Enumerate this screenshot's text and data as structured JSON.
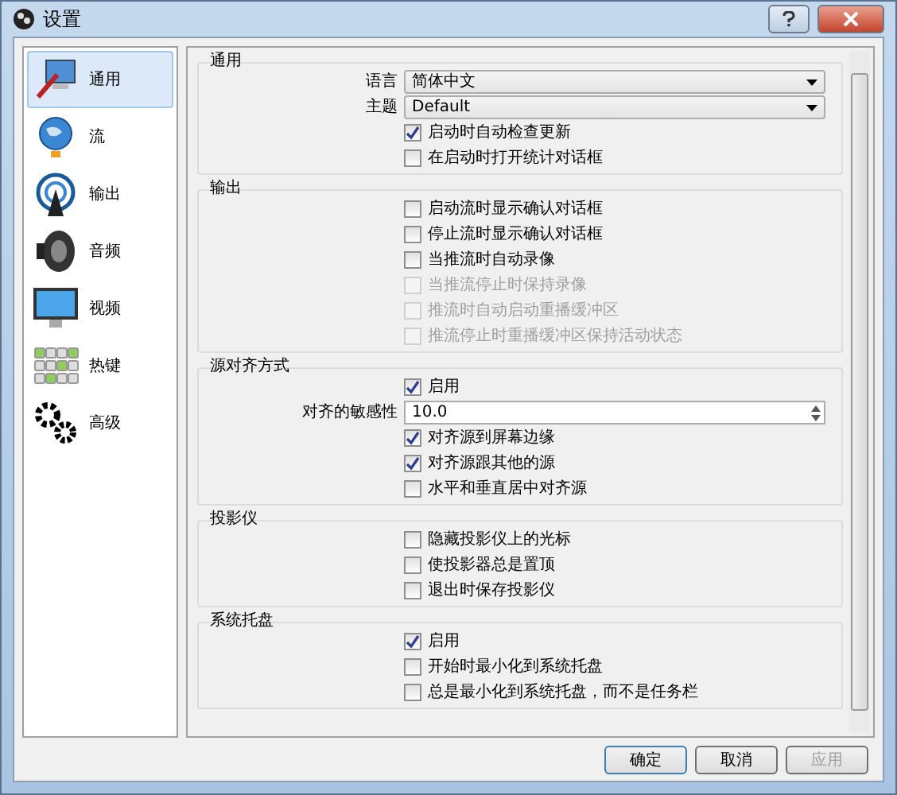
{
  "window": {
    "title": "设置"
  },
  "sidebar": {
    "items": [
      {
        "kind": "general",
        "label": "通用",
        "selected": true
      },
      {
        "kind": "stream",
        "label": "流",
        "selected": false
      },
      {
        "kind": "output",
        "label": "输出",
        "selected": false
      },
      {
        "kind": "audio",
        "label": "音频",
        "selected": false
      },
      {
        "kind": "video",
        "label": "视频",
        "selected": false
      },
      {
        "kind": "hotkeys",
        "label": "热键",
        "selected": false
      },
      {
        "kind": "advanced",
        "label": "高级",
        "selected": false
      }
    ]
  },
  "sections": [
    {
      "title": "通用",
      "items": [
        {
          "kind": "select",
          "label": "语言",
          "value": "简体中文"
        },
        {
          "kind": "select",
          "label": "主题",
          "value": "Default"
        },
        {
          "kind": "checkbox",
          "label": "启动时自动检查更新",
          "checked": true,
          "disabled": false
        },
        {
          "kind": "checkbox",
          "label": "在启动时打开统计对话框",
          "checked": false,
          "disabled": false
        }
      ]
    },
    {
      "title": "输出",
      "items": [
        {
          "kind": "checkbox",
          "label": "启动流时显示确认对话框",
          "checked": false,
          "disabled": false
        },
        {
          "kind": "checkbox",
          "label": "停止流时显示确认对话框",
          "checked": false,
          "disabled": false
        },
        {
          "kind": "checkbox",
          "label": "当推流时自动录像",
          "checked": false,
          "disabled": false
        },
        {
          "kind": "checkbox",
          "label": "当推流停止时保持录像",
          "checked": false,
          "disabled": true
        },
        {
          "kind": "checkbox",
          "label": "推流时自动启动重播缓冲区",
          "checked": false,
          "disabled": true
        },
        {
          "kind": "checkbox",
          "label": "推流停止时重播缓冲区保持活动状态",
          "checked": false,
          "disabled": true
        }
      ]
    },
    {
      "title": "源对齐方式",
      "items": [
        {
          "kind": "checkbox",
          "label": "启用",
          "checked": true,
          "disabled": false
        },
        {
          "kind": "spin",
          "label": "对齐的敏感性",
          "value": "10.0"
        },
        {
          "kind": "checkbox",
          "label": "对齐源到屏幕边缘",
          "checked": true,
          "disabled": false
        },
        {
          "kind": "checkbox",
          "label": "对齐源跟其他的源",
          "checked": true,
          "disabled": false
        },
        {
          "kind": "checkbox",
          "label": "水平和垂直居中对齐源",
          "checked": false,
          "disabled": false
        }
      ]
    },
    {
      "title": "投影仪",
      "items": [
        {
          "kind": "checkbox",
          "label": "隐藏投影仪上的光标",
          "checked": false,
          "disabled": false
        },
        {
          "kind": "checkbox",
          "label": "使投影器总是置顶",
          "checked": false,
          "disabled": false
        },
        {
          "kind": "checkbox",
          "label": "退出时保存投影仪",
          "checked": false,
          "disabled": false
        }
      ]
    },
    {
      "title": "系统托盘",
      "items": [
        {
          "kind": "checkbox",
          "label": "启用",
          "checked": true,
          "disabled": false
        },
        {
          "kind": "checkbox",
          "label": "开始时最小化到系统托盘",
          "checked": false,
          "disabled": false
        },
        {
          "kind": "checkbox",
          "label": "总是最小化到系统托盘，而不是任务栏",
          "checked": false,
          "disabled": false
        }
      ]
    }
  ],
  "buttons": [
    {
      "label": "确定",
      "default": true,
      "disabled": false
    },
    {
      "label": "取消",
      "default": false,
      "disabled": false
    },
    {
      "label": "应用",
      "default": false,
      "disabled": true
    }
  ]
}
